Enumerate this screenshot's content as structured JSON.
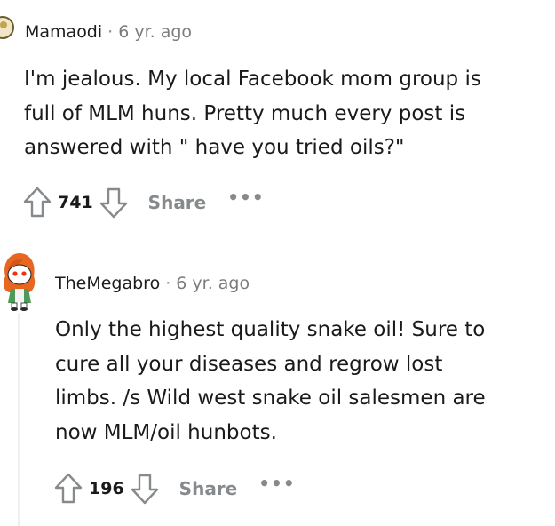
{
  "comments": [
    {
      "author": "Mamaodi",
      "age": "6 yr. ago",
      "separator": "·",
      "lines": [
        "I'm jealous. My local Facebook mom group is",
        "full of MLM huns. Pretty much every post is",
        "answered with \" have you tried oils?\""
      ],
      "votes": "741",
      "share_label": "Share",
      "more_label": "•••",
      "avatar_icon": "snoo-avatar-icon"
    },
    {
      "author": "TheMegabro",
      "age": "6 yr. ago",
      "separator": "·",
      "lines": [
        "Only the highest quality snake oil! Sure to",
        "cure all your diseases and regrow lost",
        "limbs. /s Wild west snake oil salesmen are",
        "now MLM/oil hunbots."
      ],
      "votes": "196",
      "share_label": "Share",
      "more_label": "•••",
      "avatar_icon": "snoo-avatar-icon"
    }
  ],
  "colors": {
    "text": "#1a1a1b",
    "meta": "#7c7c7c",
    "action": "#878a8c",
    "thread": "#edeff1",
    "avatar_hair": "#e8661f",
    "avatar_shirt": "#4f9a59"
  }
}
